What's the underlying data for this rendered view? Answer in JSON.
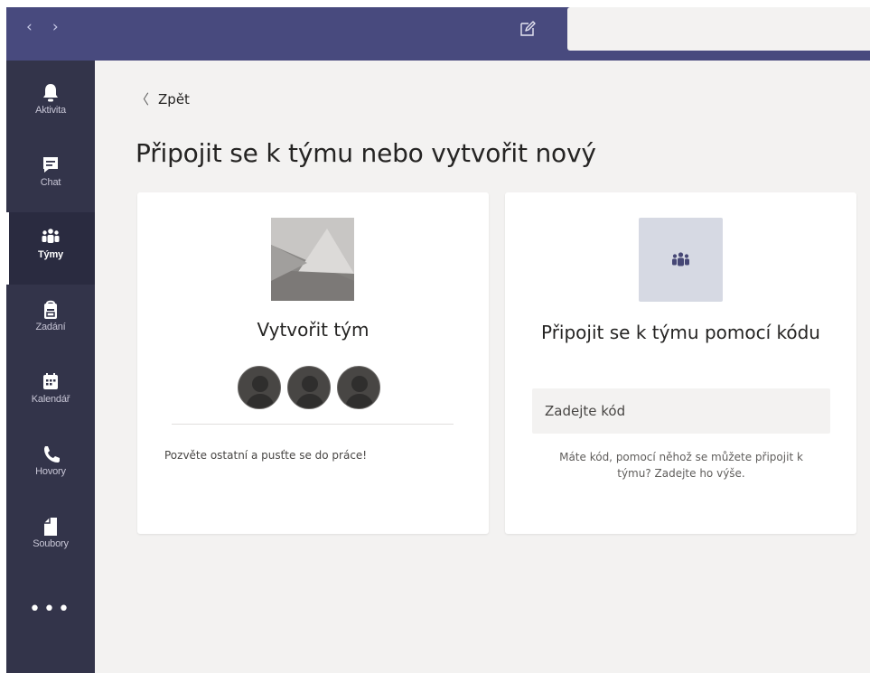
{
  "topbar": {
    "back_arrow": "‹",
    "forward_arrow": "›",
    "compose_icon": "compose-icon",
    "search_placeholder": "",
    "bar_color": "#484a7e"
  },
  "rail": {
    "items": [
      {
        "label": "Aktivita",
        "icon": "bell-icon"
      },
      {
        "label": "Chat",
        "icon": "chat-icon"
      },
      {
        "label": "Týmy",
        "icon": "teams-icon",
        "active": true
      },
      {
        "label": "Zadání",
        "icon": "assignments-icon"
      },
      {
        "label": "Kalendář",
        "icon": "calendar-icon"
      },
      {
        "label": "Hovory",
        "icon": "phone-icon"
      },
      {
        "label": "Soubory",
        "icon": "file-icon"
      }
    ],
    "more": "•••",
    "bg_color": "#33344a"
  },
  "main": {
    "back_chevron": "〈",
    "back_label": "Zpět",
    "title": "Připojit se k týmu nebo vytvořit nový",
    "bg_color": "#f3f2f1"
  },
  "create_card": {
    "title": "Vytvořit tým",
    "description": "Pozvěte ostatní a pusťte se do práce!"
  },
  "join_card": {
    "title": "Připojit se k týmu pomocí kódu",
    "input_placeholder": "Zadejte kód",
    "description": "Máte kód, pomocí něhož se můžete připojit k týmu? Zadejte ho výše."
  }
}
